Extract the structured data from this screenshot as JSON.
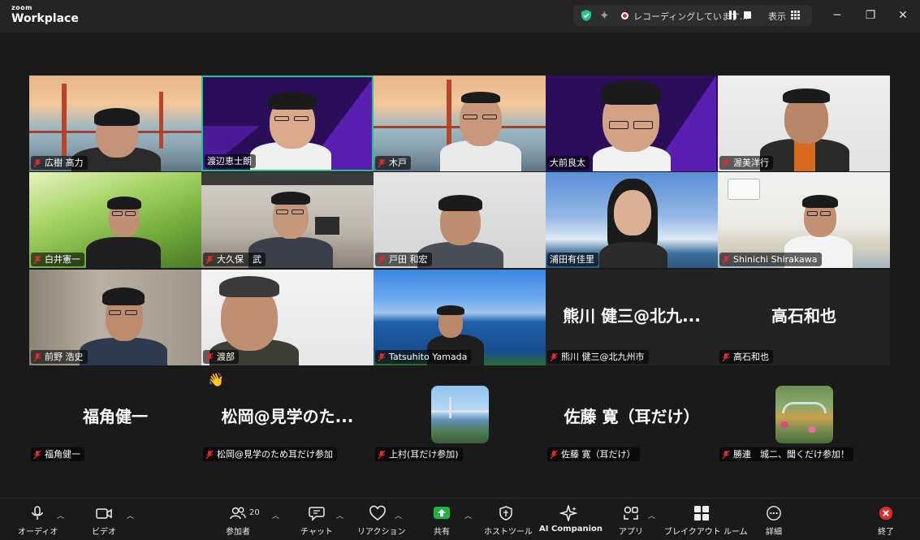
{
  "app": {
    "brand_top": "zoom",
    "brand_main": "Workplace"
  },
  "titlebar": {
    "recording_text": "レコーディングしています...",
    "view_label": "表示"
  },
  "colors": {
    "active_border": "#1ec789",
    "share_green": "#1fb141",
    "end_red": "#e02b2b",
    "shield_green": "#1ec789"
  },
  "participants_video": [
    {
      "name": "広樹 高力",
      "muted": true
    },
    {
      "name": "渡辺恵士朗",
      "muted": false,
      "active_speaker": true
    },
    {
      "name": "木戸",
      "muted": true
    },
    {
      "name": "大前良太",
      "muted": false
    },
    {
      "name": "渥美洋行",
      "muted": true
    },
    {
      "name": "白井憲一",
      "muted": true
    },
    {
      "name": "大久保　武",
      "muted": true
    },
    {
      "name": "戸田 和宏",
      "muted": true
    },
    {
      "name": "浦田有佳里",
      "muted": false
    },
    {
      "name": "Shinichi Shirakawa",
      "muted": true
    },
    {
      "name": "前野 浩史",
      "muted": true
    },
    {
      "name": "渡部",
      "muted": true
    },
    {
      "name": "Tatsuhito Yamada",
      "muted": true
    }
  ],
  "participants_novideo": [
    {
      "display": "熊川 健三@北九...",
      "name": "熊川 健三@北九州市"
    },
    {
      "display": "高石和也",
      "name": "高石和也"
    },
    {
      "display": "福角健一",
      "name": "福角健一"
    },
    {
      "display": "松岡@見学のた...",
      "name": "松岡@見学のため耳だけ参加",
      "raised_hand": true
    },
    {
      "display": "",
      "name": "上村(耳だけ参加)",
      "avatar": "bridge-photo"
    },
    {
      "display": "佐藤 寛（耳だけ）",
      "name": "佐藤 寛（耳だけ）"
    },
    {
      "display": "",
      "name": "勝連　城二、聞くだけ参加！",
      "avatar": "garden-painting"
    }
  ],
  "toolbar": {
    "audio": "オーディオ",
    "video": "ビデオ",
    "participants": "参加者",
    "participants_count": "20",
    "chat": "チャット",
    "reactions": "リアクション",
    "share": "共有",
    "host_tools": "ホストツール",
    "ai_companion": "AI Companion",
    "apps": "アプリ",
    "breakout": "ブレイクアウト ルーム",
    "more": "詳細",
    "end": "終了"
  },
  "raised_hand_icon": "waving-hand-icon"
}
